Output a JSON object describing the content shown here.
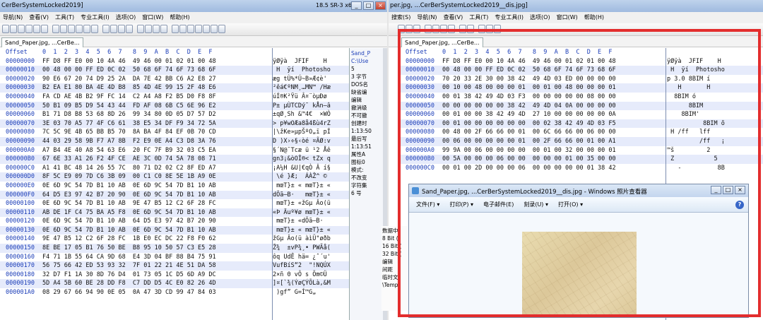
{
  "left": {
    "title": "CerBerSystemLocked2019]",
    "arch": "18.5 SR-3 x64",
    "menu": [
      "导航(N)",
      "查看(V)",
      "工具(T)",
      "专业工具(I)",
      "选项(O)",
      "窗口(W)",
      "帮助(H)"
    ],
    "tab": "Sand_Paper.jpg, ...CerBe...",
    "header": {
      "offset": "Offset",
      "cols": "0  1  2  3  4  5  6  7   8  9  A  B  C  D  E  F"
    },
    "rows": [
      {
        "off": "00000000",
        "hex": "FF D8 FF E0 00 10 4A 46  49 46 00 01 02 01 00 48",
        "asc": "ÿØÿà  JFIF    H"
      },
      {
        "off": "00000010",
        "hex": "00 48 00 00 FF ED 0C 02  50 68 6F 74 6F 73 68 6F",
        "asc": " H  ÿí  Photosho"
      },
      {
        "off": "00000020",
        "hex": "90 E6 67 20 74 D9 25 2A  DA 7E 42 BB C6 A2 E8 27",
        "asc": "æg tÙ%*Ú~B»Æ¢è'"
      },
      {
        "off": "00000030",
        "hex": "B2 EA E1 80 BA 4E 4D B8  85 4D 4E 99 15 2F 48 E6",
        "asc": "²êá€ºNM¸…MN™ /Hæ"
      },
      {
        "off": "00000040",
        "hex": "FA CD AE 4B B2 9F FC 14  C2 A4 A8 F2 B5 D0 F8 8F",
        "asc": "úÍ®K²Ÿü Â¤¨òµÐø"
      },
      {
        "off": "00000050",
        "hex": "50 B1 09 B5 D9 54 43 44  FD AF 08 6B C5 6E 96 E2",
        "asc": "P± µÙTCDý¯ kÅn–â"
      },
      {
        "off": "00000060",
        "hex": "B1 71 D8 B8 53 68 8D 26  99 34 80 0D 05 D7 57 D2",
        "asc": "±qØ¸Sh &™4€  ×WÒ"
      },
      {
        "off": "00000070",
        "hex": "3E 03 70 A5 77 4F C6 61  38 E5 34 DF F9 34 72 5A",
        "asc": "> p¥wOÆa8å4ßù4rZ"
      },
      {
        "off": "00000080",
        "hex": "7C 5C 9E 4B 65 BB B5 70  8A BA 4F 84 EF 0B 70 CD",
        "asc": "|\\žKe»µpŠºO„ï pÍ"
      },
      {
        "off": "00000090",
        "hex": "44 03 29 58 9B F7 A7 8B  F2 E9 0E A4 C3 D8 3A 76",
        "asc": "D )X›÷§‹òé ¤ÃØ:v"
      },
      {
        "off": "000000A0",
        "hex": "A7 B4 4E 40 A8 54 63 E6  20 FC 7F B9 32 03 C5 EA",
        "asc": "§´N@¨Tcæ ü ¹2 Åê"
      },
      {
        "off": "000000B0",
        "hex": "67 6E 33 A1 26 F2 4F CE  AE 3C 0D 74 5A 78 08 71",
        "asc": "gn3¡&òOÎ®< tZx q"
      },
      {
        "off": "000000C0",
        "hex": "A1 41 BC 48 14 26 55 7C  80 71 D2 02 C2 8F ED A7",
        "asc": "¡A¼H &U|€qÒ Â í§"
      },
      {
        "off": "000000D0",
        "hex": "8F 5C E9 09 7D C6 3B 09  00 C1 C0 8E 5E 1B A9 0E",
        "asc": " \\é }Æ;  ÁÀŽ^ © "
      },
      {
        "off": "000000E0",
        "hex": "0E 6D 9C 54 7D B1 10 AB  0E 6D 9C 54 7D B1 10 AB",
        "asc": " mœT}± « mœT}± «"
      },
      {
        "off": "000000F0",
        "hex": "64 D5 E3 97 42 B7 20 90  0E 6D 9C 54 7D B1 10 AB",
        "asc": "dÕã—B·   mœT}± «"
      },
      {
        "off": "00000100",
        "hex": "0E 6D 9C 54 7D B1 10 AB  9E 47 B5 12 C2 6F 28 FC",
        "asc": " mœT}± «žGµ Âo(ü"
      },
      {
        "off": "00000110",
        "hex": "AB DE 1F C4 75 BA A5 F8  0E 6D 9C 54 7D B1 10 AB",
        "asc": "«Þ Äuº¥ø mœT}± «"
      },
      {
        "off": "00000120",
        "hex": "0E 6D 9C 54 7D B1 10 AB  64 D5 E3 97 42 B7 20 90",
        "asc": " mœT}± «dÕã—B·  "
      },
      {
        "off": "00000130",
        "hex": "0E 6D 9C 54 7D B1 10 AB  0E 6D 9C 54 7D B1 10 AB",
        "asc": " mœT}± « mœT}± «"
      },
      {
        "off": "00000140",
        "hex": "9E 47 B5 12 C2 6F 28 FC  1B E0 EC DC 22 F8 F0 62",
        "asc": "žGµ Âo(ü àìÜ\"øðb"
      },
      {
        "off": "00000150",
        "hex": "8E BE 17 05 B1 76 50 BE  B8 95 10 50 57 C3 E5 28",
        "asc": "Ž¾  ±vP¾¸• PWÃå("
      },
      {
        "off": "00000160",
        "hex": "F4 71 1B 55 64 CA 9D 68  E4 3D 04 BF 88 B4 75 91",
        "asc": "ôq UdÊ hä= ¿ˆ´u'"
      },
      {
        "off": "00000170",
        "hex": "56 75 66 42 ED 53 93 32  7F 01 22 21 4E 51 DA 58",
        "asc": "VufBíS“2  \"!NQÚX"
      },
      {
        "off": "00000180",
        "hex": "32 D7 F1 1A 30 8D 76 D4  01 73 05 1C D5 6D A9 DC",
        "asc": "2×ñ 0 vÔ s Õm©Ü"
      },
      {
        "off": "00000190",
        "hex": "5D A4 5B 60 BE 28 DD F8  C7 DD D5 4C E0 82 26 4D",
        "asc": "]¤[`¾(ÝøÇÝÕLà‚&M"
      },
      {
        "off": "000001A0",
        "hex": "08 29 67 66 94 90 0E 05  0A 47 3D CD 99 47 84 03",
        "asc": " )gf” G=Í™G„ "
      }
    ],
    "side": [
      "Sand_P",
      "C:\\Use",
      "",
      "5 ",
      "3 字节",
      "",
      "DOS名",
      "",
      "缺省编",
      "编辑",
      "",
      "撤消级",
      "不可撤",
      "",
      "创建时",
      "1:13:50",
      "",
      "最后写",
      "1:13:51",
      "",
      "属性A",
      "图标0",
      "",
      "模式:",
      "不改变",
      "字符集",
      "6 号"
    ]
  },
  "right": {
    "title": "per.jpg, ...CerBerSystemLocked2019__dis.jpg]",
    "menu": [
      "搜索(S)",
      "导航(N)",
      "查看(V)",
      "工具(T)",
      "专业工具(I)",
      "选项(O)",
      "窗口(W)",
      "帮助(H)"
    ],
    "tab": "Sand_Paper.jpg, ...CerBe...",
    "header": {
      "offset": "Offset",
      "cols": "0  1  2  3  4  5  6  7   8  9  A  B  C  D  E  F"
    },
    "rows": [
      {
        "off": "00000000",
        "hex": "FF D8 FF E0 00 10 4A 46  49 46 00 01 02 01 00 48",
        "asc": "ÿØÿà  JFIF    H"
      },
      {
        "off": "00000010",
        "hex": "00 48 00 00 FF ED 0C 02  50 68 6F 74 6F 73 68 6F",
        "asc": " H  ÿí  Photosho"
      },
      {
        "off": "00000020",
        "hex": "70 20 33 2E 30 00 38 42  49 4D 03 ED 00 00 00 00",
        "asc": "p 3.0 8BIM í    "
      },
      {
        "off": "00000030",
        "hex": "00 10 00 48 00 00 00 01  00 01 00 48 00 00 00 01",
        "asc": "   H       H    "
      },
      {
        "off": "00000040",
        "hex": "00 01 38 42 49 4D 03 F3  00 00 00 00 00 08 00 00",
        "asc": "  8BIM ó        "
      },
      {
        "off": "00000050",
        "hex": "00 00 00 00 00 00 38 42  49 4D 04 0A 00 00 00 00",
        "asc": "      8BIM      "
      },
      {
        "off": "00000060",
        "hex": "00 01 00 00 38 42 49 4D  27 10 00 00 00 00 00 0A",
        "asc": "    8BIM'       "
      },
      {
        "off": "00000070",
        "hex": "00 01 00 00 00 00 00 00  00 02 38 42 49 4D 03 F5",
        "asc": "          8BIM õ"
      },
      {
        "off": "00000080",
        "hex": "00 48 00 2F 66 66 00 01  00 6C 66 66 00 06 00 00",
        "asc": " H /ff   lff    "
      },
      {
        "off": "00000090",
        "hex": "00 06 00 00 00 00 00 01  00 2F 66 66 00 01 00 A1",
        "asc": "         /ff   ¡"
      },
      {
        "off": "000000A0",
        "hex": "99 9A 00 06 00 00 00 00  00 01 00 32 00 00 00 01",
        "asc": "™š         2    "
      },
      {
        "off": "000000B0",
        "hex": "00 5A 00 00 00 06 00 00  00 00 00 01 00 35 00 00",
        "asc": " Z           5  "
      },
      {
        "off": "000000C0",
        "hex": "00 01 00 2D 00 00 00 06  00 00 00 00 00 01 38 42",
        "asc": "   -          8B"
      }
    ]
  },
  "viewer": {
    "title": "Sand_Paper.jpg, ...CerBerSystemLocked2019__dis.jpg - Windows 照片查看器",
    "commands": [
      "文件(F) ▾",
      "打印(P) ▾",
      "电子邮件(E)",
      "刻录(U) ▾",
      "打开(O) ▾"
    ]
  },
  "midstrip": [
    "数据中",
    "",
    "8 Bit (",
    "16 Bit (",
    "32 Bit (",
    "",
    "编辑",
    "",
    "间距",
    "",
    "临时文",
    "\\Temp"
  ],
  "colors": {
    "highlight": "#e32d2d",
    "hex_blue": "#1b3db8"
  }
}
